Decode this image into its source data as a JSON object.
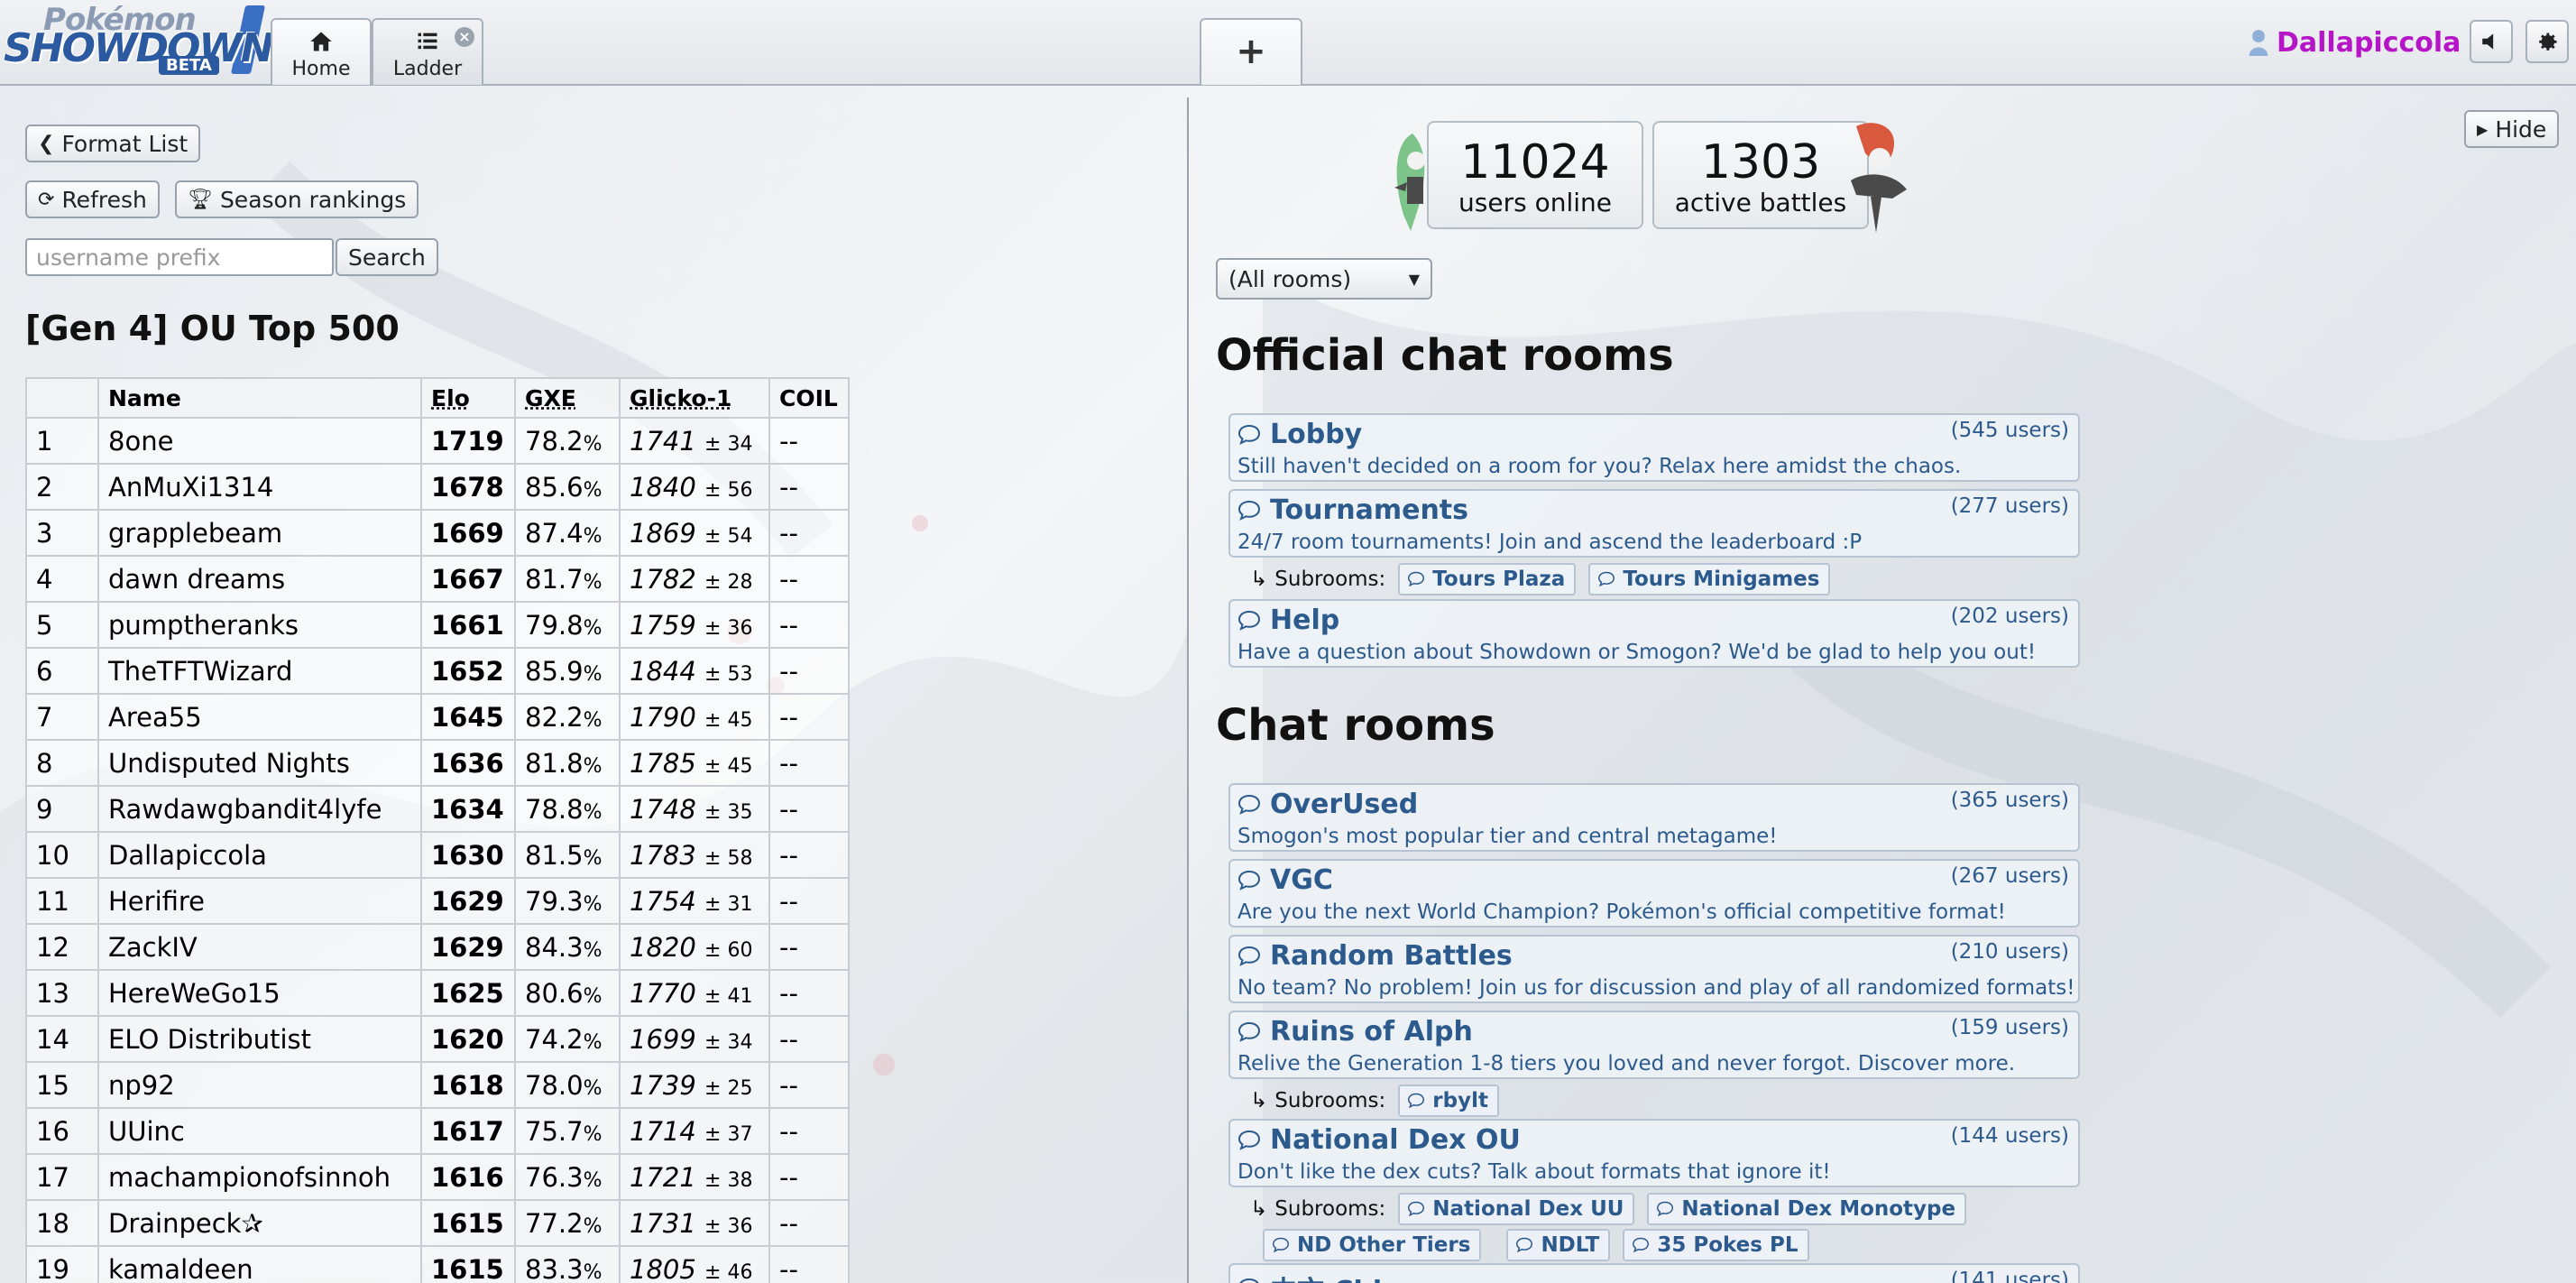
{
  "header": {
    "logo": {
      "line1": "Pokémon",
      "line2": "SHOWDOWN",
      "badge": "BETA"
    },
    "tabs": [
      {
        "label": "Home",
        "icon": "home-icon"
      },
      {
        "label": "Ladder",
        "icon": "list-icon"
      }
    ],
    "new_tab_label": "+",
    "username": "Dallapiccola",
    "accent_username_color": "#b515c6"
  },
  "left": {
    "format_list_label": "Format List",
    "refresh_label": "Refresh",
    "season_rankings_label": "Season rankings",
    "search_placeholder": "username prefix",
    "search_label": "Search",
    "title": "[Gen 4] OU Top 500",
    "columns": [
      "",
      "Name",
      "Elo",
      "GXE",
      "Glicko-1",
      "COIL"
    ],
    "rows": [
      {
        "rank": "1",
        "name": "8one",
        "elo": "1719",
        "gxe": "78.2",
        "glicko": "1741",
        "dev": "± 34",
        "coil": "--"
      },
      {
        "rank": "2",
        "name": "AnMuXi1314",
        "elo": "1678",
        "gxe": "85.6",
        "glicko": "1840",
        "dev": "± 56",
        "coil": "--"
      },
      {
        "rank": "3",
        "name": "grapplebeam",
        "elo": "1669",
        "gxe": "87.4",
        "glicko": "1869",
        "dev": "± 54",
        "coil": "--"
      },
      {
        "rank": "4",
        "name": "dawn dreams",
        "elo": "1667",
        "gxe": "81.7",
        "glicko": "1782",
        "dev": "± 28",
        "coil": "--"
      },
      {
        "rank": "5",
        "name": "pumptheranks",
        "elo": "1661",
        "gxe": "79.8",
        "glicko": "1759",
        "dev": "± 36",
        "coil": "--"
      },
      {
        "rank": "6",
        "name": "TheTFTWizard",
        "elo": "1652",
        "gxe": "85.9",
        "glicko": "1844",
        "dev": "± 53",
        "coil": "--"
      },
      {
        "rank": "7",
        "name": "Area55",
        "elo": "1645",
        "gxe": "82.2",
        "glicko": "1790",
        "dev": "± 45",
        "coil": "--"
      },
      {
        "rank": "8",
        "name": "Undisputed Nights",
        "elo": "1636",
        "gxe": "81.8",
        "glicko": "1785",
        "dev": "± 45",
        "coil": "--"
      },
      {
        "rank": "9",
        "name": "Rawdawgbandit4lyfe",
        "elo": "1634",
        "gxe": "78.8",
        "glicko": "1748",
        "dev": "± 35",
        "coil": "--"
      },
      {
        "rank": "10",
        "name": "Dallapiccola",
        "elo": "1630",
        "gxe": "81.5",
        "glicko": "1783",
        "dev": "± 58",
        "coil": "--"
      },
      {
        "rank": "11",
        "name": "Herifire",
        "elo": "1629",
        "gxe": "79.3",
        "glicko": "1754",
        "dev": "± 31",
        "coil": "--"
      },
      {
        "rank": "12",
        "name": "ZackIV",
        "elo": "1629",
        "gxe": "84.3",
        "glicko": "1820",
        "dev": "± 60",
        "coil": "--"
      },
      {
        "rank": "13",
        "name": "HereWeGo15",
        "elo": "1625",
        "gxe": "80.6",
        "glicko": "1770",
        "dev": "± 41",
        "coil": "--"
      },
      {
        "rank": "14",
        "name": "ELO Distributist",
        "elo": "1620",
        "gxe": "74.2",
        "glicko": "1699",
        "dev": "± 34",
        "coil": "--"
      },
      {
        "rank": "15",
        "name": "np92",
        "elo": "1618",
        "gxe": "78.0",
        "glicko": "1739",
        "dev": "± 25",
        "coil": "--"
      },
      {
        "rank": "16",
        "name": "UUinc",
        "elo": "1617",
        "gxe": "75.7",
        "glicko": "1714",
        "dev": "± 37",
        "coil": "--"
      },
      {
        "rank": "17",
        "name": "machampionofsinnoh",
        "elo": "1616",
        "gxe": "76.3",
        "glicko": "1721",
        "dev": "± 38",
        "coil": "--"
      },
      {
        "rank": "18",
        "name": "Drainpeck✰",
        "elo": "1615",
        "gxe": "77.2",
        "glicko": "1731",
        "dev": "± 36",
        "coil": "--"
      },
      {
        "rank": "19",
        "name": "kamaldeen",
        "elo": "1615",
        "gxe": "83.3",
        "glicko": "1805",
        "dev": "± 46",
        "coil": "--"
      }
    ]
  },
  "right": {
    "hide_label": "Hide",
    "users_online_count": "11024",
    "users_online_label": "users online",
    "active_battles_count": "1303",
    "active_battles_label": "active battles",
    "room_filter": "(All rooms)",
    "official_title": "Official chat rooms",
    "chat_title": "Chat rooms",
    "subrooms_label": "Subrooms:",
    "official_rooms": [
      {
        "name": "Lobby",
        "users": "(545 users)",
        "desc": "Still haven't decided on a room for you? Relax here amidst the chaos.",
        "subrooms": []
      },
      {
        "name": "Tournaments",
        "users": "(277 users)",
        "desc": "24/7 room tournaments! Join and ascend the leaderboard :P",
        "subrooms": [
          "Tours Plaza",
          "Tours Minigames"
        ]
      },
      {
        "name": "Help",
        "users": "(202 users)",
        "desc": "Have a question about Showdown or Smogon? We'd be glad to help you out!",
        "subrooms": []
      }
    ],
    "chat_rooms": [
      {
        "name": "OverUsed",
        "users": "(365 users)",
        "desc": "Smogon's most popular tier and central metagame!",
        "subrooms": []
      },
      {
        "name": "VGC",
        "users": "(267 users)",
        "desc": "Are you the next World Champion? Pokémon's official competitive format!",
        "subrooms": []
      },
      {
        "name": "Random Battles",
        "users": "(210 users)",
        "desc": "No team? No problem! Join us for discussion and play of all randomized formats!",
        "subrooms": []
      },
      {
        "name": "Ruins of Alph",
        "users": "(159 users)",
        "desc": "Relive the Generation 1-8 tiers you loved and never forgot. Discover more.",
        "subrooms": [
          "rbylt"
        ]
      },
      {
        "name": "National Dex OU",
        "users": "(144 users)",
        "desc": "Don't like the dex cuts? Talk about formats that ignore it!",
        "subrooms": [
          "National Dex UU",
          "National Dex Monotype",
          "ND Other Tiers",
          "NDLT",
          "35 Pokes PL"
        ]
      },
      {
        "name": "中文 Chinese",
        "users": "(141 users)",
        "desc": "",
        "subrooms": []
      }
    ],
    "room_color": "#2c5a8c"
  }
}
